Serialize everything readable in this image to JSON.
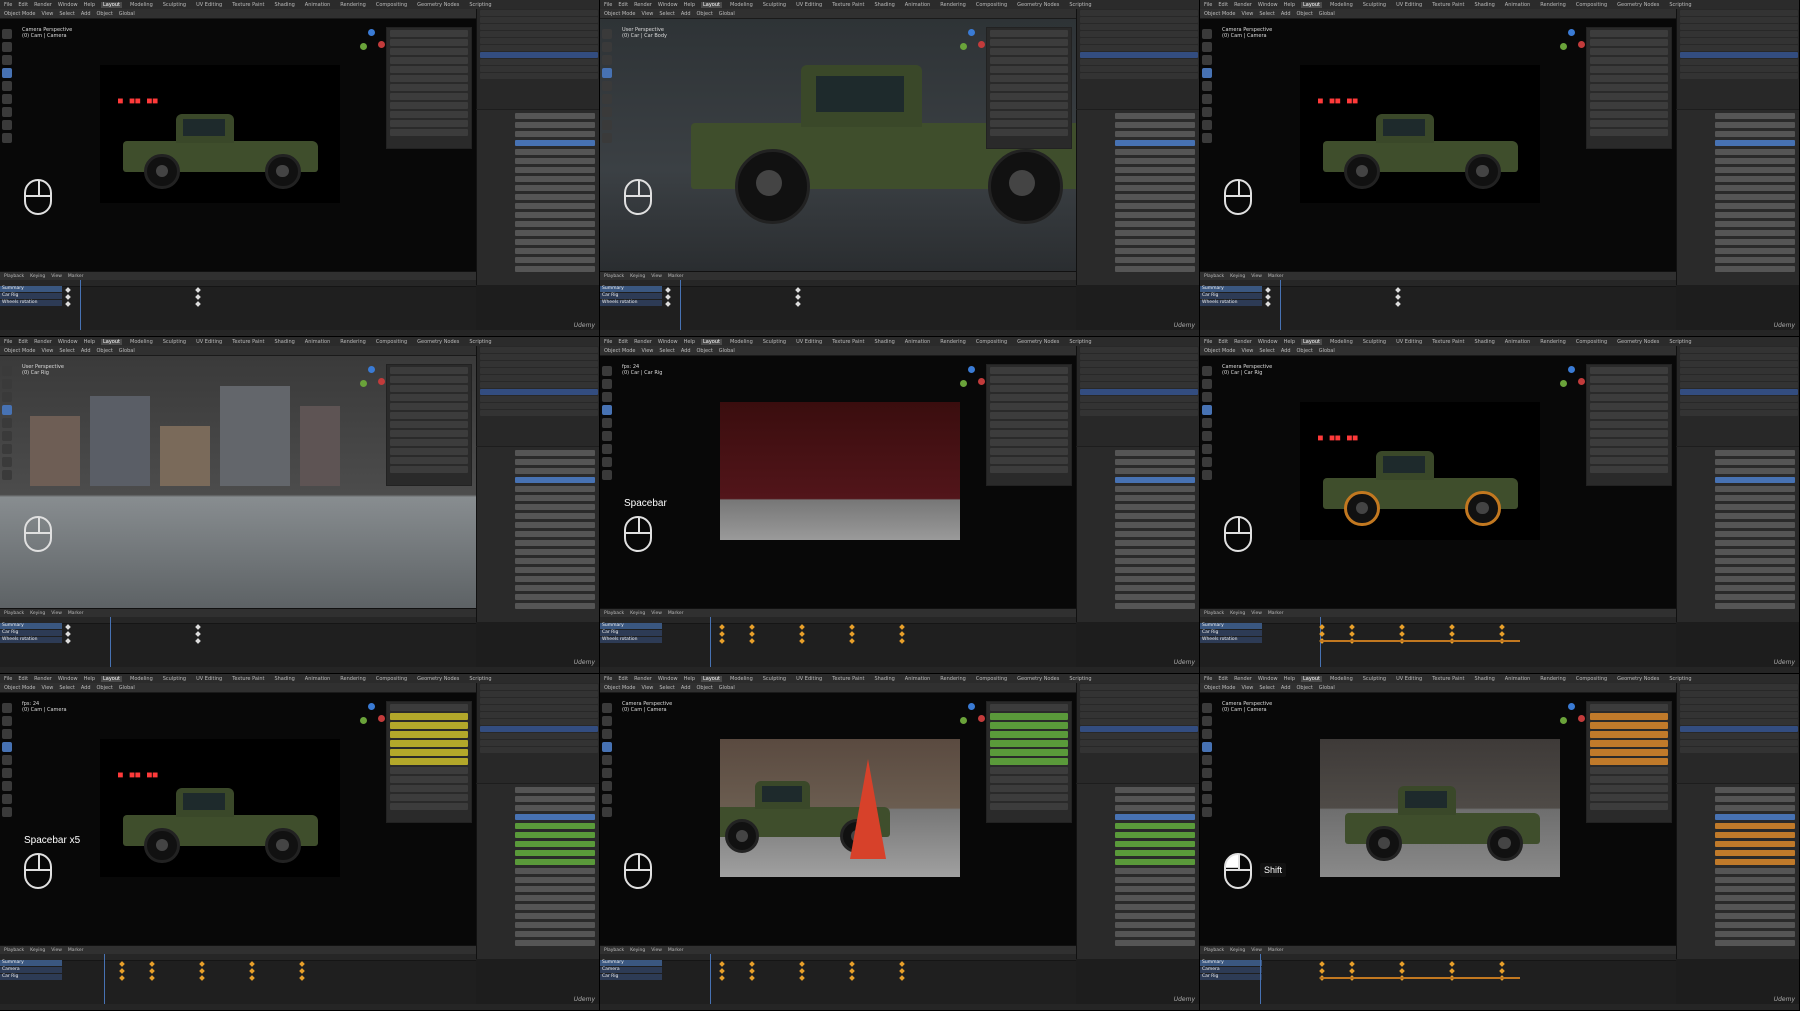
{
  "app": {
    "menu": [
      "File",
      "Edit",
      "Render",
      "Window",
      "Help"
    ],
    "workspaces": [
      "Layout",
      "Modeling",
      "Sculpting",
      "UV Editing",
      "Texture Paint",
      "Shading",
      "Animation",
      "Rendering",
      "Compositing",
      "Geometry Nodes",
      "Scripting"
    ],
    "active_workspace": "Layout",
    "viewport_header": [
      "Object Mode",
      "View",
      "Select",
      "Add",
      "Object",
      "Global"
    ],
    "timeline_header": [
      "Playback",
      "Keying",
      "View",
      "Marker"
    ],
    "summary_label": "Summary",
    "watermark": "Udemy"
  },
  "tiles": [
    {
      "id": "t1",
      "view_title": "Camera Perspective",
      "view_sub": "(0) Cam | Camera",
      "overlay": "",
      "mouse": "idle",
      "scene": "truck-brick",
      "channels": [
        "Summary",
        "Car Rig",
        "Wheels rotation"
      ]
    },
    {
      "id": "t2",
      "view_title": "User Perspective",
      "view_sub": "(0) Car | Car Body",
      "overlay": "",
      "mouse": "idle",
      "scene": "truck-closeup",
      "channels": [
        "Summary",
        "Car Rig",
        "Wheels rotation"
      ]
    },
    {
      "id": "t3",
      "view_title": "Camera Perspective",
      "view_sub": "(0) Cam | Camera",
      "overlay": "",
      "mouse": "idle",
      "scene": "truck-brick",
      "channels": [
        "Summary",
        "Car Rig",
        "Wheels rotation"
      ]
    },
    {
      "id": "t4",
      "view_title": "User Perspective",
      "view_sub": "(0) Car Rig",
      "overlay": "",
      "mouse": "idle",
      "scene": "city",
      "channels": [
        "Summary",
        "Car Rig",
        "Wheels rotation"
      ]
    },
    {
      "id": "t5",
      "view_title": "fps: 24",
      "view_sub": "(0) Car | Car Rig",
      "overlay": "Spacebar",
      "mouse": "idle",
      "scene": "closeup-red",
      "channels": [
        "Summary",
        "Car Rig",
        "Wheels rotation"
      ]
    },
    {
      "id": "t6",
      "view_title": "Camera Perspective",
      "view_sub": "(0) Car | Car Rig",
      "overlay": "",
      "mouse": "idle",
      "scene": "truck-wheels",
      "channels": [
        "Summary",
        "Car Rig",
        "Wheels rotation"
      ]
    },
    {
      "id": "t7",
      "view_title": "fps: 24",
      "view_sub": "(0) Cam | Camera",
      "overlay": "Spacebar x5",
      "mouse": "idle",
      "scene": "truck-brick",
      "channels": [
        "Summary",
        "Camera",
        "Car Rig"
      ]
    },
    {
      "id": "t8",
      "view_title": "Camera Perspective",
      "view_sub": "(0) Cam | Camera",
      "overlay": "",
      "mouse": "idle",
      "scene": "truck-cone",
      "channels": [
        "Summary",
        "Camera",
        "Car Rig"
      ]
    },
    {
      "id": "t9",
      "view_title": "Camera Perspective",
      "view_sub": "(0) Cam | Camera",
      "overlay": "Shift",
      "mouse": "left",
      "scene": "truck-plain",
      "channels": [
        "Summary",
        "Camera",
        "Car Rig"
      ]
    }
  ],
  "colors": {
    "accent": "#4772b3",
    "keyframe": "#e8a02a",
    "keyed_field": "#b3a82a",
    "animated_field": "#5a9a3a",
    "neon": "#ff3a3a"
  }
}
